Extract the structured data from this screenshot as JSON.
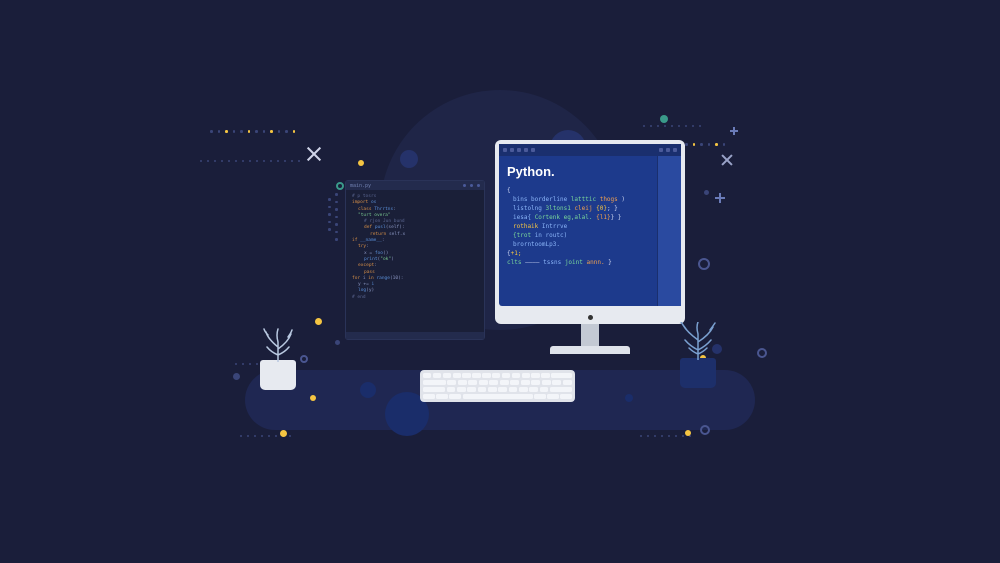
{
  "monitor": {
    "title": "Python.",
    "code": [
      {
        "indent": 0,
        "segs": [
          {
            "t": "",
            "c": "kw"
          }
        ]
      },
      {
        "indent": 0,
        "segs": [
          {
            "t": "{",
            "c": ""
          }
        ]
      },
      {
        "indent": 1,
        "segs": [
          {
            "t": "bins borderline",
            "c": "fn"
          },
          {
            "t": " latttic ",
            "c": "str"
          },
          {
            "t": "thogs",
            "c": "num"
          },
          {
            "t": " )",
            "c": ""
          }
        ]
      },
      {
        "indent": 1,
        "segs": [
          {
            "t": "listolng ",
            "c": "fn"
          },
          {
            "t": "3ltons1 ",
            "c": "str"
          },
          {
            "t": "cleij ",
            "c": "num"
          },
          {
            "t": "{0}",
            "c": "kw"
          },
          {
            "t": ";  }",
            "c": ""
          }
        ]
      },
      {
        "indent": 1,
        "segs": [
          {
            "t": "iesa{ ",
            "c": "fn"
          },
          {
            "t": "Cortenk eg,alal. ",
            "c": "str"
          },
          {
            "t": "{l1}",
            "c": "num"
          },
          {
            "t": "} }",
            "c": ""
          }
        ]
      },
      {
        "indent": 1,
        "segs": [
          {
            "t": "rothaik ",
            "c": "kw"
          },
          {
            "t": "Intrrve",
            "c": "fn"
          }
        ]
      },
      {
        "indent": 1,
        "segs": [
          {
            "t": "{trot ",
            "c": "str"
          },
          {
            "t": "in routc)",
            "c": "fn"
          }
        ]
      },
      {
        "indent": 1,
        "segs": [
          {
            "t": "brorntoomLp3.",
            "c": "fn"
          }
        ]
      },
      {
        "indent": 0,
        "segs": [
          {
            "t": "{",
            "c": ""
          },
          {
            "t": "+1;",
            "c": "kw"
          }
        ]
      },
      {
        "indent": 0,
        "segs": [
          {
            "t": "clts  ",
            "c": "str"
          },
          {
            "t": "———— ",
            "c": ""
          },
          {
            "t": "tssns ",
            "c": "fn"
          },
          {
            "t": "joint ",
            "c": "str"
          },
          {
            "t": "annn.",
            "c": "num"
          },
          {
            "t": " }",
            "c": ""
          }
        ]
      }
    ]
  },
  "codewin": {
    "tab": "main.py",
    "code": [
      {
        "indent": 0,
        "segs": [
          {
            "t": "# p tosrs",
            "c": "cmt"
          }
        ]
      },
      {
        "indent": 0,
        "segs": [
          {
            "t": "import ",
            "c": "kw"
          },
          {
            "t": "os",
            "c": "fn"
          }
        ]
      },
      {
        "indent": 1,
        "segs": [
          {
            "t": "class ",
            "c": "kw"
          },
          {
            "t": "Thrrtns",
            "c": "fn"
          },
          {
            "t": ":",
            "c": ""
          }
        ]
      },
      {
        "indent": 1,
        "segs": [
          {
            "t": "\"turt overa\"",
            "c": "str"
          }
        ]
      },
      {
        "indent": 2,
        "segs": [
          {
            "t": "# rjon Jun bund",
            "c": "cmt"
          }
        ]
      },
      {
        "indent": 2,
        "segs": [
          {
            "t": "def ",
            "c": "kw"
          },
          {
            "t": "pusl",
            "c": "fn"
          },
          {
            "t": "(self):",
            "c": ""
          }
        ]
      },
      {
        "indent": 3,
        "segs": [
          {
            "t": "return ",
            "c": "kw"
          },
          {
            "t": "self.x",
            "c": ""
          }
        ]
      },
      {
        "indent": 0,
        "segs": [
          {
            "t": "",
            "c": ""
          }
        ]
      },
      {
        "indent": 0,
        "segs": [
          {
            "t": "if ",
            "c": "kw"
          },
          {
            "t": "__name__",
            "c": "fn"
          },
          {
            "t": ":",
            "c": ""
          }
        ]
      },
      {
        "indent": 1,
        "segs": [
          {
            "t": "try",
            ":": "",
            "c": "kw"
          },
          {
            "t": ":",
            "c": ""
          }
        ]
      },
      {
        "indent": 2,
        "segs": [
          {
            "t": "x = ",
            "c": ""
          },
          {
            "t": "foo",
            "c": "fn"
          },
          {
            "t": "()",
            "c": ""
          }
        ]
      },
      {
        "indent": 2,
        "segs": [
          {
            "t": "print",
            "c": "fn"
          },
          {
            "t": "(",
            "c": ""
          },
          {
            "t": "\"ok\"",
            "c": "str"
          },
          {
            "t": ")",
            "c": ""
          }
        ]
      },
      {
        "indent": 1,
        "segs": [
          {
            "t": "except",
            "c": "kw"
          },
          {
            "t": ":",
            "c": ""
          }
        ]
      },
      {
        "indent": 2,
        "segs": [
          {
            "t": "pass",
            "c": "kw"
          }
        ]
      },
      {
        "indent": 0,
        "segs": [
          {
            "t": "",
            "c": ""
          }
        ]
      },
      {
        "indent": 0,
        "segs": [
          {
            "t": "for ",
            "c": "kw"
          },
          {
            "t": "i ",
            "c": ""
          },
          {
            "t": "in ",
            "c": "kw"
          },
          {
            "t": "range",
            "c": "fn"
          },
          {
            "t": "(10):",
            "c": ""
          }
        ]
      },
      {
        "indent": 1,
        "segs": [
          {
            "t": "y += ",
            "c": ""
          },
          {
            "t": "i",
            "c": "fn"
          }
        ]
      },
      {
        "indent": 1,
        "segs": [
          {
            "t": "log",
            "c": "fn"
          },
          {
            "t": "(y)",
            "c": ""
          }
        ]
      },
      {
        "indent": 0,
        "segs": [
          {
            "t": "# end",
            "c": "cmt"
          }
        ]
      }
    ]
  }
}
